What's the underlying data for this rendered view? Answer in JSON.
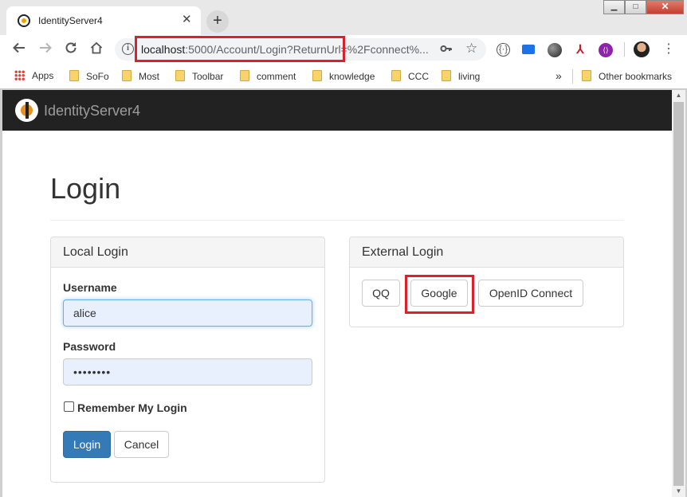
{
  "browser": {
    "tab": {
      "title": "IdentityServer4",
      "close": "✕"
    },
    "new_tab": "+",
    "window_controls": {
      "minimize": "▁",
      "maximize": "□",
      "close": "✕"
    },
    "url": {
      "host": "localhost",
      "path": ":5000/Account/Login?ReturnUrl=%2Fconnect%..."
    },
    "info_icon": "i",
    "bookmarks": [
      {
        "label": "Apps"
      },
      {
        "label": "SoFo"
      },
      {
        "label": "Most"
      },
      {
        "label": "Toolbar"
      },
      {
        "label": "comment"
      },
      {
        "label": "knowledge"
      },
      {
        "label": "CCC"
      },
      {
        "label": "living"
      }
    ],
    "overflow": "»",
    "other_bookmarks": "Other bookmarks"
  },
  "site": {
    "brand": "IdentityServer4",
    "title": "Login",
    "local_login": {
      "heading": "Local Login",
      "username_label": "Username",
      "username_value": "alice",
      "password_label": "Password",
      "password_value": "••••••••",
      "remember_label": "Remember My Login",
      "login_button": "Login",
      "cancel_button": "Cancel"
    },
    "external_login": {
      "heading": "External Login",
      "providers": [
        "QQ",
        "Google",
        "OpenID Connect"
      ]
    }
  },
  "colors": {
    "annotation_red": "#d9222b",
    "navbar": "#222222",
    "primary": "#337ab7",
    "logo_accent": "#e8911e"
  }
}
